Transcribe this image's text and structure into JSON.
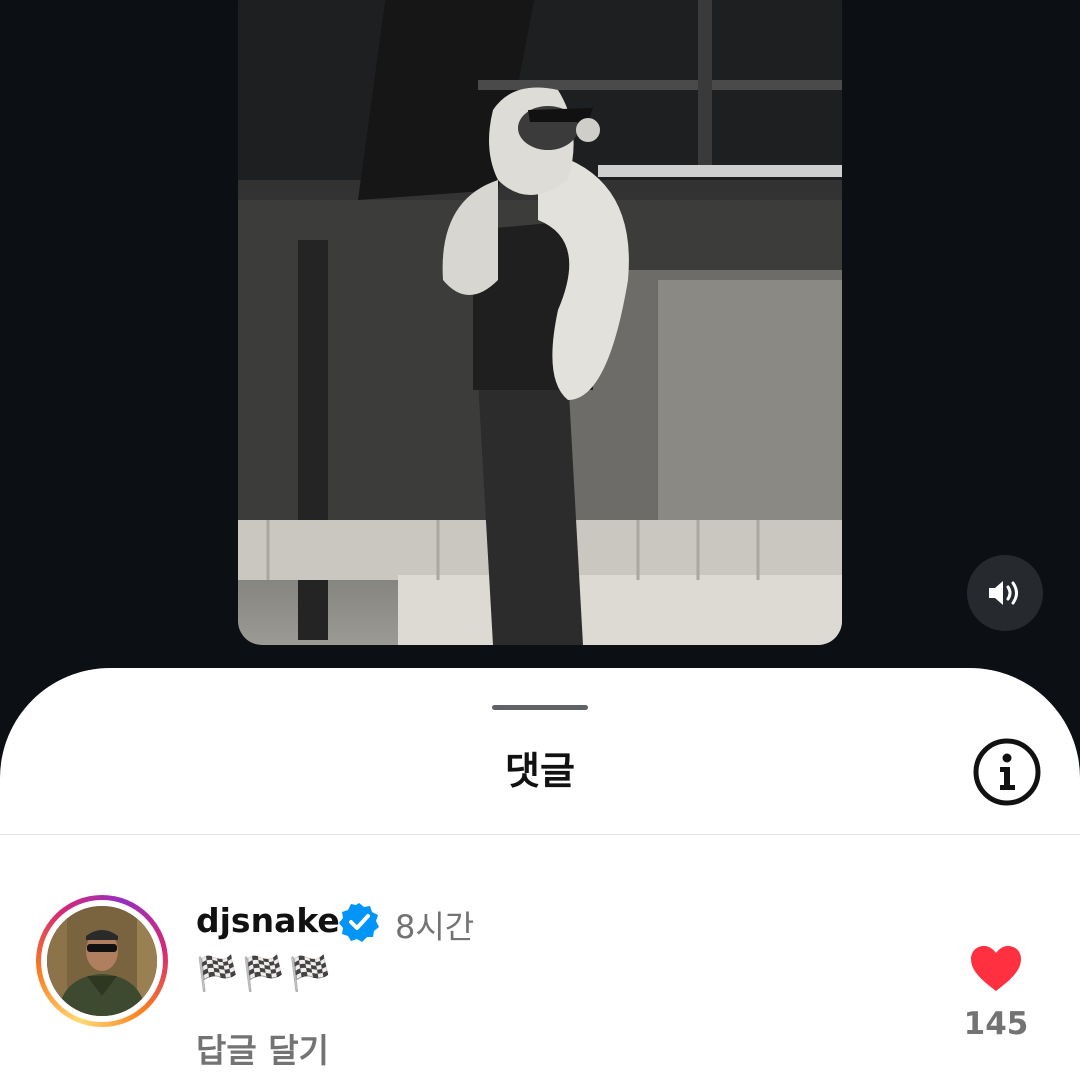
{
  "comments_sheet": {
    "title": "댓글"
  },
  "comment": {
    "username": "djsnake",
    "verified": true,
    "time": "8시간",
    "text_emojis": [
      "🏁",
      "🏁",
      "🏁"
    ],
    "reply_label": "답글 달기",
    "like_count": "145",
    "liked": true
  },
  "icons": {
    "sound": "speaker-volume-icon",
    "info": "info-circle-icon",
    "verified": "verified-badge-icon",
    "like": "heart-icon"
  },
  "colors": {
    "background": "#0c1014",
    "like_red": "#ff3040",
    "verified_blue": "#0095f6",
    "secondary_text": "#737373"
  }
}
